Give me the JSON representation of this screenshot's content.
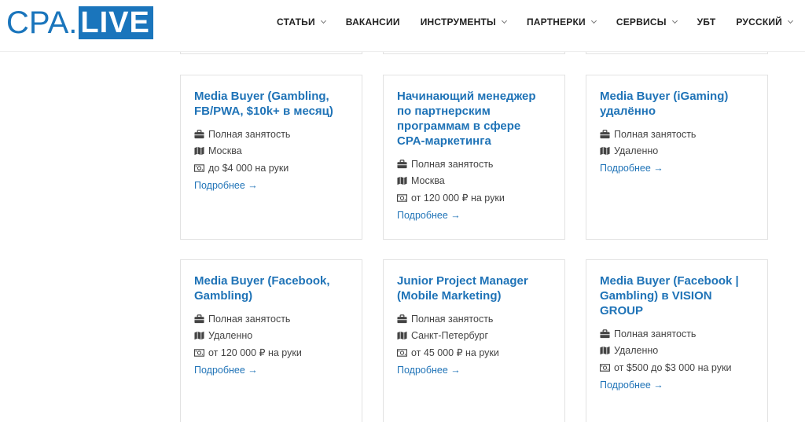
{
  "header": {
    "logo_cpa": "CPA.",
    "logo_live": "LIVE",
    "nav": [
      {
        "label": "СТАТЬИ",
        "has_dropdown": true
      },
      {
        "label": "ВАКАНСИИ",
        "has_dropdown": false
      },
      {
        "label": "ИНСТРУМЕНТЫ",
        "has_dropdown": true
      },
      {
        "label": "ПАРТНЕРКИ",
        "has_dropdown": true
      },
      {
        "label": "СЕРВИСЫ",
        "has_dropdown": true
      },
      {
        "label": "УБТ",
        "has_dropdown": false
      },
      {
        "label": "РУССКИЙ",
        "has_dropdown": true
      }
    ]
  },
  "jobs": [
    {
      "title": "Media Buyer (Gambling, FB/PWA, $10k+ в месяц)",
      "employment": "Полная занятость",
      "location": "Москва",
      "salary": "до $4 000 на руки",
      "more": "Подробнее →"
    },
    {
      "title": "Начинающий менеджер по партнерским программам в сфере CPA-маркетинга",
      "employment": "Полная занятость",
      "location": "Москва",
      "salary": "от 120 000 ₽ на руки",
      "more": "Подробнее →"
    },
    {
      "title": "Media Buyer (iGaming) удалённо",
      "employment": "Полная занятость",
      "location": "Удаленно",
      "salary": "",
      "more": "Подробнее →"
    },
    {
      "title": "Media Buyer (Facebook, Gambling)",
      "employment": "Полная занятость",
      "location": "Удаленно",
      "salary": "от 120 000 ₽ на руки",
      "more": "Подробнее →"
    },
    {
      "title": "Junior Project Manager (Mobile Marketing)",
      "employment": "Полная занятость",
      "location": "Санкт-Петербург",
      "salary": "от 45 000 ₽ на руки",
      "more": "Подробнее →"
    },
    {
      "title": "Media Buyer (Facebook | Gambling) в VISION GROUP",
      "employment": "Полная занятость",
      "location": "Удаленно",
      "salary": "от $500 до $3 000 на руки",
      "more": "Подробнее →"
    }
  ],
  "icons": {
    "employment": "briefcase-icon",
    "location": "map-icon",
    "salary": "money-icon"
  },
  "colors": {
    "brand": "#1a75bc",
    "link": "#1f73b7",
    "text": "#444444",
    "border": "#e2e2e2"
  }
}
